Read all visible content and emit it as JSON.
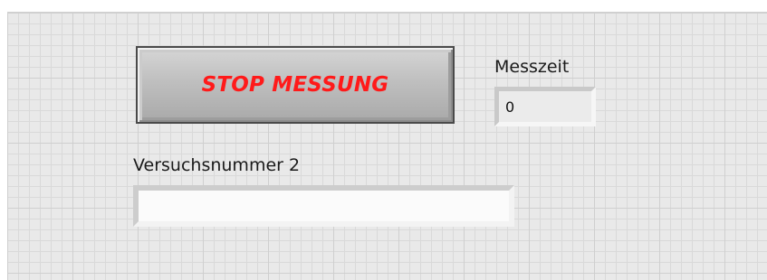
{
  "front_panel": {
    "stop_button": {
      "label": "STOP MESSUNG",
      "text_color": "#ff1a1a"
    },
    "messzeit": {
      "label": "Messzeit",
      "value": "0"
    },
    "versuchsnummer": {
      "label": "Versuchsnummer 2",
      "value": ""
    }
  }
}
